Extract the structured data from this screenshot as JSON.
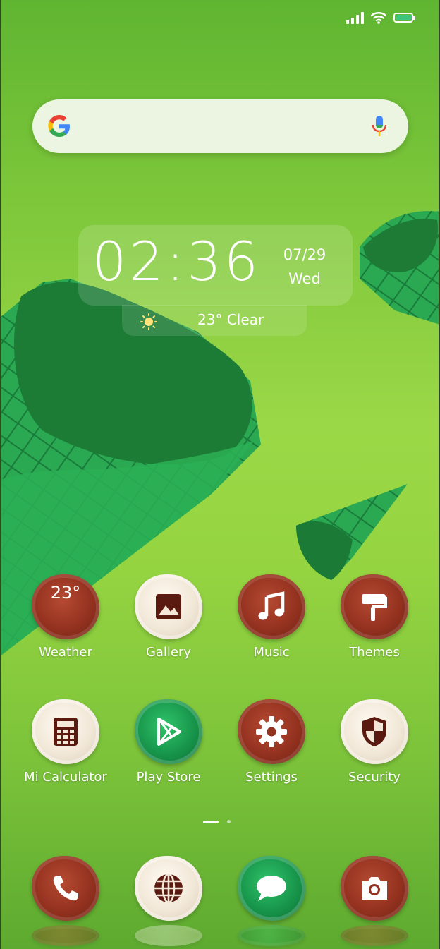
{
  "clock": {
    "time": "02:36",
    "date": "07/29",
    "day": "Wed",
    "weather": "23° Clear"
  },
  "apps_row1": [
    {
      "label": "Weather",
      "badge": "23°"
    },
    {
      "label": "Gallery"
    },
    {
      "label": "Music"
    },
    {
      "label": "Themes"
    }
  ],
  "apps_row2": [
    {
      "label": "Mi Calculator"
    },
    {
      "label": "Play Store"
    },
    {
      "label": "Settings"
    },
    {
      "label": "Security"
    }
  ],
  "dock": [
    "phone-icon",
    "browser-icon",
    "messages-icon",
    "camera-icon"
  ],
  "pager": {
    "pages": 2,
    "current": 1
  },
  "colors": {
    "chocolate": "#93311f",
    "vanilla": "#f1e7d7",
    "mint": "#17944a",
    "battery": "#3ec77a"
  }
}
